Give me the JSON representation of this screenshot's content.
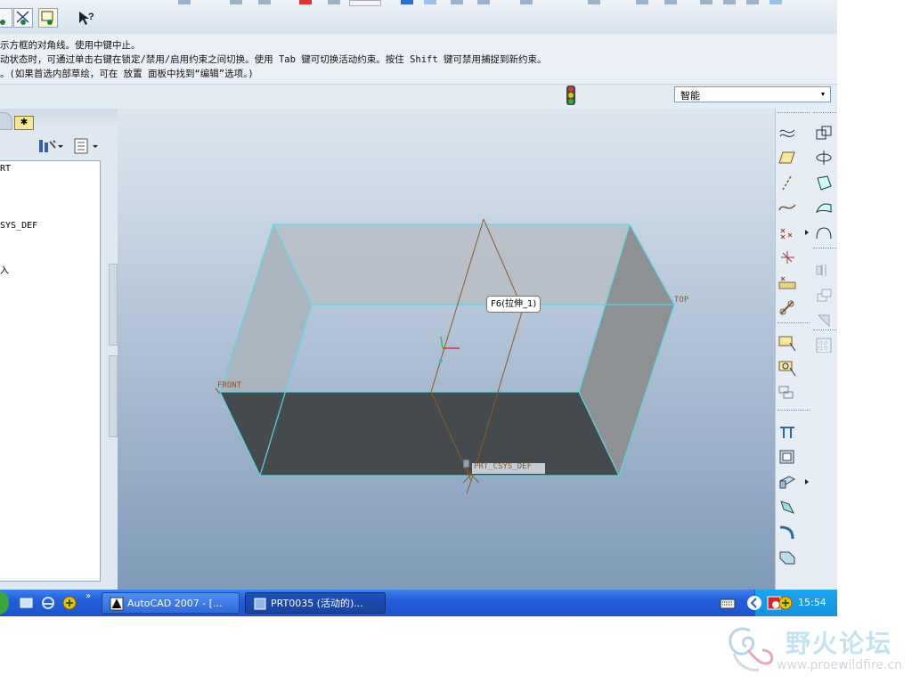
{
  "messages": [
    "示方框的对角线。使用中键中止。",
    "动状态时，可通过单击右键在锁定/禁用/启用约束之间切换。使用 Tab 键可切换活动约束。按住 Shift 键可禁用捕捉到新约束。",
    "。(如果首选内部草绘，可在 放置 面板中找到“编辑”选项。)"
  ],
  "filter": {
    "value": "智能",
    "arrow": "▾"
  },
  "model_tree": {
    "items": [
      "RT",
      "SYS_DEF",
      "入"
    ],
    "tab_symbol": "✱"
  },
  "viewport": {
    "feature_tag": "F6(拉伸_1)",
    "datum_top": "TOP",
    "datum_front": "FRONT",
    "csys_label": "PRT_CSYS_DEF",
    "colors": {
      "edge": "#5ad8e6",
      "datum": "#8a5a2a",
      "face_dark": "#454a4e"
    }
  },
  "taskbar": {
    "items": [
      {
        "label": "AutoCAD 2007 - [..."
      },
      {
        "label": "PRT0035 (活动的)..."
      }
    ],
    "clock": "15:54"
  },
  "watermark": {
    "name": "野火论坛",
    "url": "www.proewildfire.cn"
  }
}
